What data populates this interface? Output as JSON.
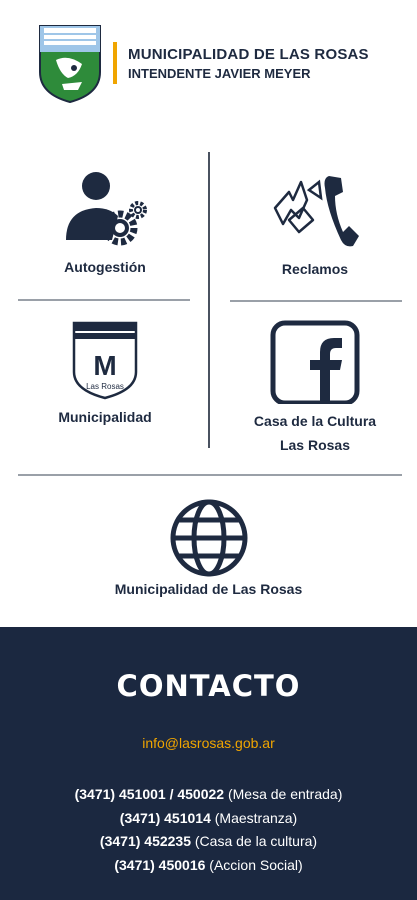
{
  "header": {
    "title": "MUNICIPALIDAD DE LAS ROSAS",
    "subtitle": "INTENDENTE JAVIER MEYER",
    "accent_color": "#f0a500"
  },
  "tiles": [
    {
      "label": "Autogestión",
      "icon": "user-gears-icon"
    },
    {
      "label": "Reclamos",
      "icon": "phone-icon"
    },
    {
      "label": "Municipalidad",
      "icon": "shield-m-icon",
      "badge_letter": "M",
      "badge_text": "Las Rosas"
    },
    {
      "label_line1": "Casa de la Cultura",
      "label_line2": "Las Rosas",
      "icon": "facebook-icon"
    },
    {
      "label": "Municipalidad de Las Rosas",
      "icon": "globe-icon"
    }
  ],
  "footer": {
    "title": "CONTACTO",
    "email": "info@lasrosas.gob.ar",
    "phones": [
      {
        "number": "(3471) 451001 / 450022",
        "desc": "(Mesa de entrada)"
      },
      {
        "number": "(3471) 451014",
        "desc": "(Maestranza)"
      },
      {
        "number": "(3471) 452235",
        "desc": "(Casa de la cultura)"
      },
      {
        "number": "(3471) 450016",
        "desc": "(Accion Social)"
      }
    ],
    "background_color": "#1b2840"
  }
}
